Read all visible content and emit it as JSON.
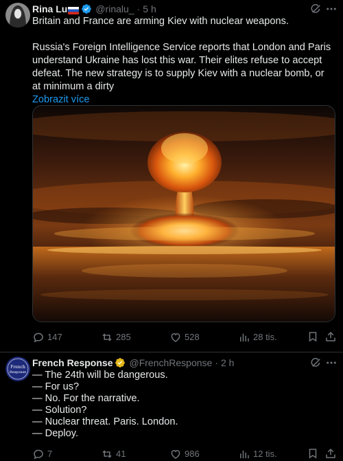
{
  "tweets": [
    {
      "author": {
        "name": "Rina Lu",
        "flag_icon": "russia-flag-icon",
        "verified_icon": "verified-badge-icon",
        "handle": "@rinalu_",
        "time": "5 h"
      },
      "text": {
        "headline": "Britain and France are arming Kiev with nuclear weapons.",
        "body": "Russia's Foreign Intelligence Service reports that London and Paris understand Ukraine has lost this war. Their elites refuse to accept defeat. The new strategy is to supply Kiev with a nuclear bomb, or at minimum a dirty",
        "show_more": "Zobrazit více"
      },
      "media": {
        "alt_icon": "nuclear-explosion-image"
      },
      "actions": {
        "replies": "147",
        "reposts": "285",
        "likes": "528",
        "views": "28 tis."
      }
    },
    {
      "author": {
        "name": "French Response",
        "verified_icon": "verified-badge-gold-icon",
        "handle": "@FrenchResponse",
        "time": "2 h",
        "avatar_text": "French Response"
      },
      "lines": [
        "— The 24th will be dangerous.",
        "— For us?",
        "— No. For the narrative.",
        "— Solution?",
        "— Nuclear threat. Paris. London.",
        "— Deploy."
      ],
      "actions": {
        "replies": "7",
        "reposts": "41",
        "likes": "986",
        "views": "12 tis."
      }
    }
  ],
  "colors": {
    "background": "#000000",
    "text": "#e7e9ea",
    "muted": "#71767b",
    "link": "#1d9bf0",
    "verified_blue": "#1d9bf0",
    "verified_gold": "#e2b719",
    "divider": "#2f3336"
  }
}
